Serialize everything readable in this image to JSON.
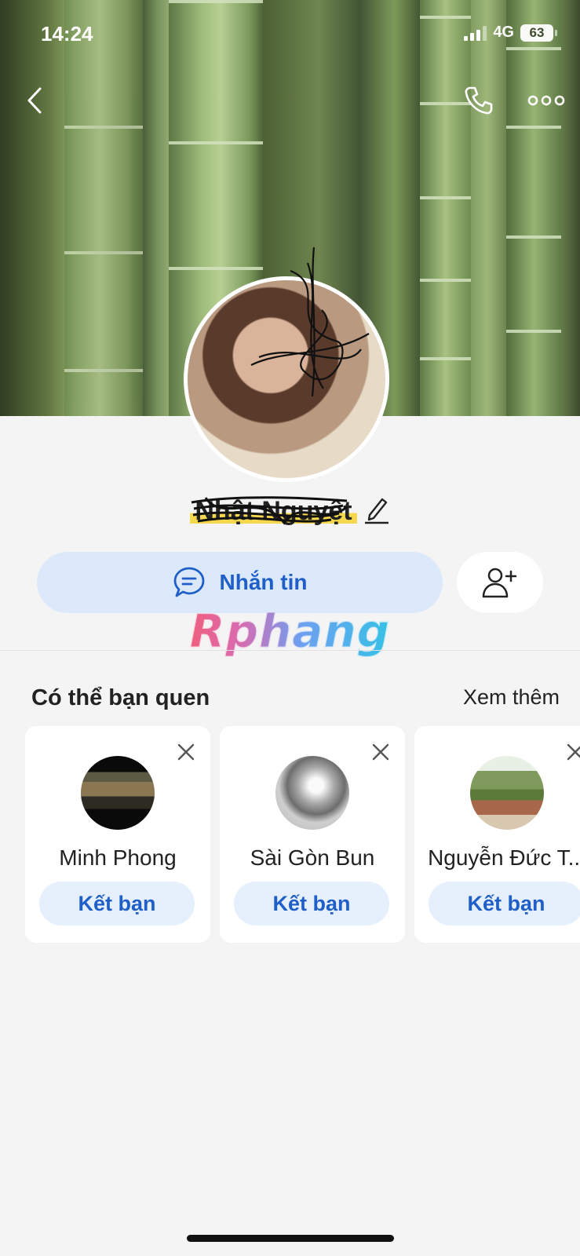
{
  "status_bar": {
    "time": "14:24",
    "network": "4G",
    "battery": "63"
  },
  "header": {
    "back_icon": "chevron-left-icon",
    "call_icon": "phone-icon",
    "more_icon": "more-horizontal-icon"
  },
  "profile": {
    "name": "Nhật Nguyệt",
    "edit_icon": "pencil-icon"
  },
  "actions": {
    "message_label": "Nhắn tin",
    "message_icon": "chat-bubble-icon",
    "add_friend_icon": "add-user-icon"
  },
  "watermark": "Rphang",
  "suggestions": {
    "title": "Có thể bạn quen",
    "see_more": "Xem thêm",
    "items": [
      {
        "name": "Minh Phong",
        "button": "Kết bạn"
      },
      {
        "name": "Sài Gòn Bun",
        "button": "Kết bạn"
      },
      {
        "name": "Nguyễn Đức T...",
        "button": "Kết bạn"
      }
    ]
  },
  "colors": {
    "accent": "#1f5fc7",
    "button_bg": "#dbe9fb",
    "page_bg": "#f4f4f5"
  }
}
